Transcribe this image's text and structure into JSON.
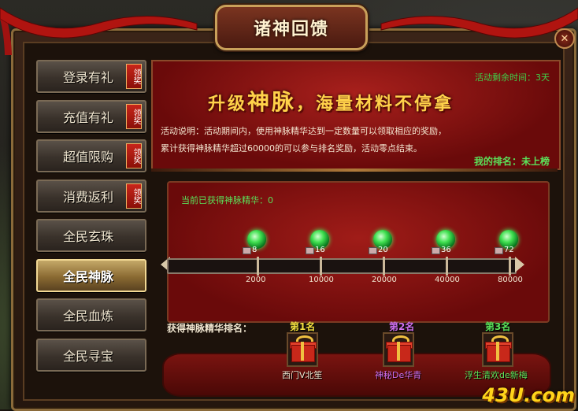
{
  "window": {
    "title": "诸神回馈",
    "close_icon": "close-icon"
  },
  "sidebar": {
    "items": [
      {
        "label": "登录有礼",
        "tag": "领奖",
        "active": false
      },
      {
        "label": "充值有礼",
        "tag": "领奖",
        "active": false
      },
      {
        "label": "超值限购",
        "tag": "领奖",
        "active": false
      },
      {
        "label": "消费返利",
        "tag": "领奖",
        "active": false
      },
      {
        "label": "全民玄珠",
        "tag": "",
        "active": false
      },
      {
        "label": "全民神脉",
        "tag": "",
        "active": true
      },
      {
        "label": "全民血炼",
        "tag": "",
        "active": false
      },
      {
        "label": "全民寻宝",
        "tag": "",
        "active": false
      }
    ]
  },
  "event": {
    "remaining": "活动剩余时间：3天",
    "banner_prefix": "升级",
    "banner_big": "神脉",
    "banner_suffix": "，海量材料不停拿",
    "desc_line1": "活动说明：活动期间内，使用神脉精华达到一定数量可以领取相应的奖励，",
    "desc_line2": "累计获得神脉精华超过60000的可以参与排名奖励，活动零点结束。",
    "my_rank": "我的排名：未上榜"
  },
  "progress": {
    "current_label": "当前已获得神脉精华：0",
    "current_value": 0,
    "milestones": [
      {
        "threshold": "2000",
        "reward_count": "8"
      },
      {
        "threshold": "10000",
        "reward_count": "16"
      },
      {
        "threshold": "20000",
        "reward_count": "20"
      },
      {
        "threshold": "40000",
        "reward_count": "36"
      },
      {
        "threshold": "80000",
        "reward_count": "72"
      }
    ],
    "accent_color": "#40e050"
  },
  "ranking": {
    "title": "获得神脉精华排名：",
    "places": [
      {
        "place": "第1名",
        "name": "西门V北笙",
        "place_color": "#f4e040",
        "name_color": "#f0e6d0"
      },
      {
        "place": "第2名",
        "name": "神秘De华青",
        "place_color": "#d070f0",
        "name_color": "#d070f0"
      },
      {
        "place": "第3名",
        "name": "浮生清欢de新梅",
        "place_color": "#5ae25a",
        "name_color": "#5ae25a"
      }
    ]
  },
  "watermark": "43U.com"
}
